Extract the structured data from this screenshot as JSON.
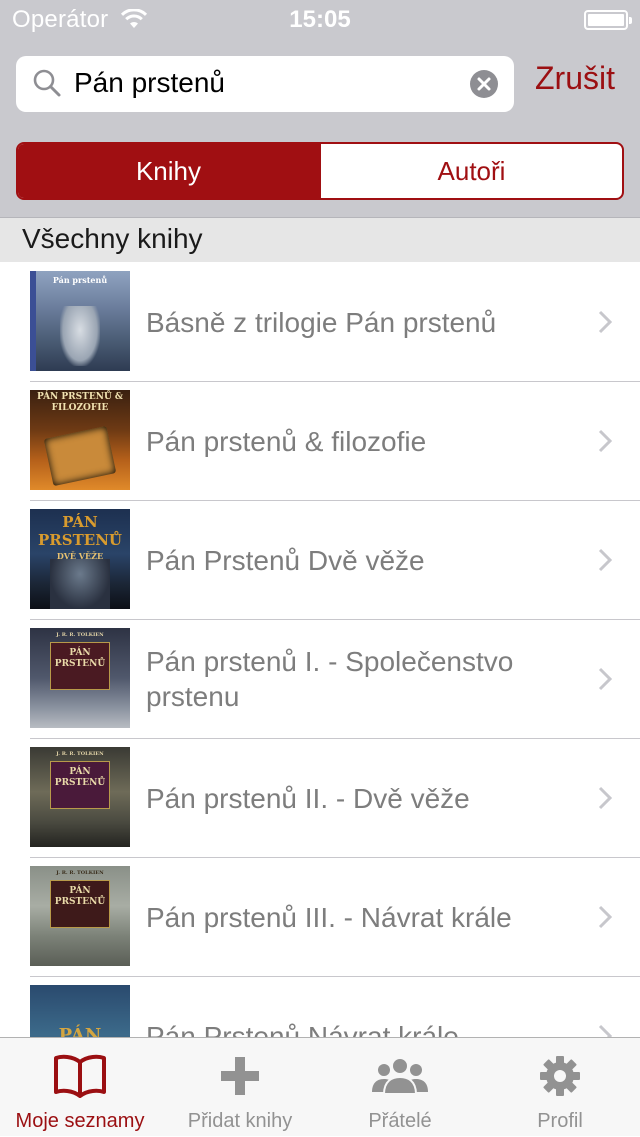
{
  "status_bar": {
    "carrier": "Operátor",
    "time": "15:05"
  },
  "search": {
    "query": "Pán prstenů",
    "cancel_label": "Zrušit"
  },
  "segments": [
    {
      "label": "Knihy",
      "selected": true
    },
    {
      "label": "Autoři",
      "selected": false
    }
  ],
  "section": {
    "title": "Všechny knihy"
  },
  "books": [
    {
      "title": "Básně z trilogie Pán prstenů",
      "cover_text": "Pán prstenů"
    },
    {
      "title": "Pán prstenů & filozofie",
      "cover_text": "PÁN PRSTENŮ & FILOZOFIE"
    },
    {
      "title": "Pán Prstenů Dvě věže",
      "cover_text": "PÁN PRSTENŮ",
      "cover_sub": "DVĚ VĚŽE"
    },
    {
      "title": "Pán prstenů I. - Společenstvo prstenu",
      "cover_text": "PÁN PRSTENŮ",
      "cover_author": "J. R. R. TOLKIEN"
    },
    {
      "title": "Pán prstenů II. - Dvě věže",
      "cover_text": "PÁN PRSTENŮ",
      "cover_author": "J. R. R. TOLKIEN"
    },
    {
      "title": "Pán prstenů III. - Návrat krále",
      "cover_text": "PÁN PRSTENŮ",
      "cover_author": "J. R. R. TOLKIEN"
    },
    {
      "title": "Pán Prstenů Návrat krále",
      "cover_text": "PÁN"
    }
  ],
  "tabbar": [
    {
      "label": "Moje seznamy",
      "icon": "book-icon",
      "active": true
    },
    {
      "label": "Přidat knihy",
      "icon": "plus-icon",
      "active": false
    },
    {
      "label": "Přátelé",
      "icon": "people-icon",
      "active": false
    },
    {
      "label": "Profil",
      "icon": "gear-icon",
      "active": false
    }
  ],
  "colors": {
    "accent": "#9b0f12",
    "header_bg": "#c9c9ce",
    "section_bg": "#e6e6e6",
    "tab_inactive": "#929292",
    "row_text": "#7d7d7d"
  }
}
